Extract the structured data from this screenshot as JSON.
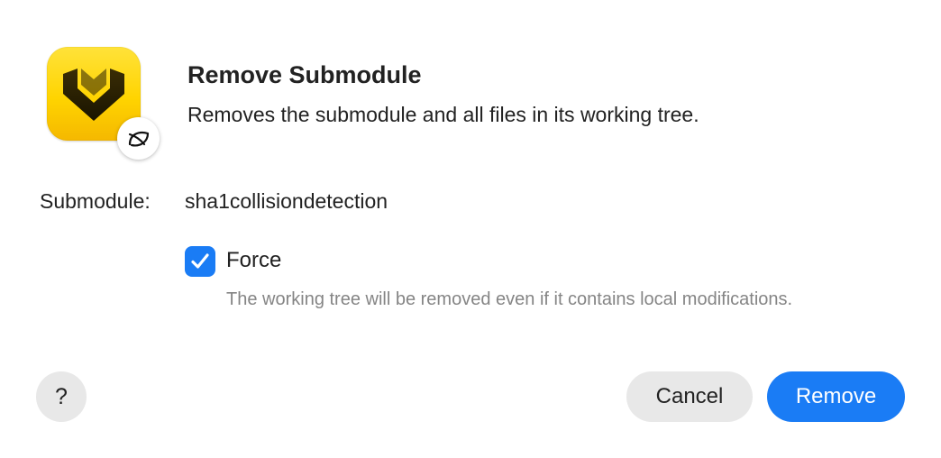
{
  "dialog": {
    "title": "Remove Submodule",
    "subtitle": "Removes the submodule and all files in its working tree.",
    "app_icon": "fork-app-icon",
    "badge_icon": "leaf-icon"
  },
  "submodule": {
    "label": "Submodule:",
    "value": "sha1collisiondetection"
  },
  "force": {
    "checked": true,
    "label": "Force",
    "hint": "The working tree will be removed even if it contains local modifications."
  },
  "buttons": {
    "help": "?",
    "cancel": "Cancel",
    "remove": "Remove"
  },
  "colors": {
    "accent": "#1a7cf5",
    "secondary_button": "#e8e8e8",
    "hint_text": "#858585",
    "app_icon_yellow": "#ffd400"
  }
}
